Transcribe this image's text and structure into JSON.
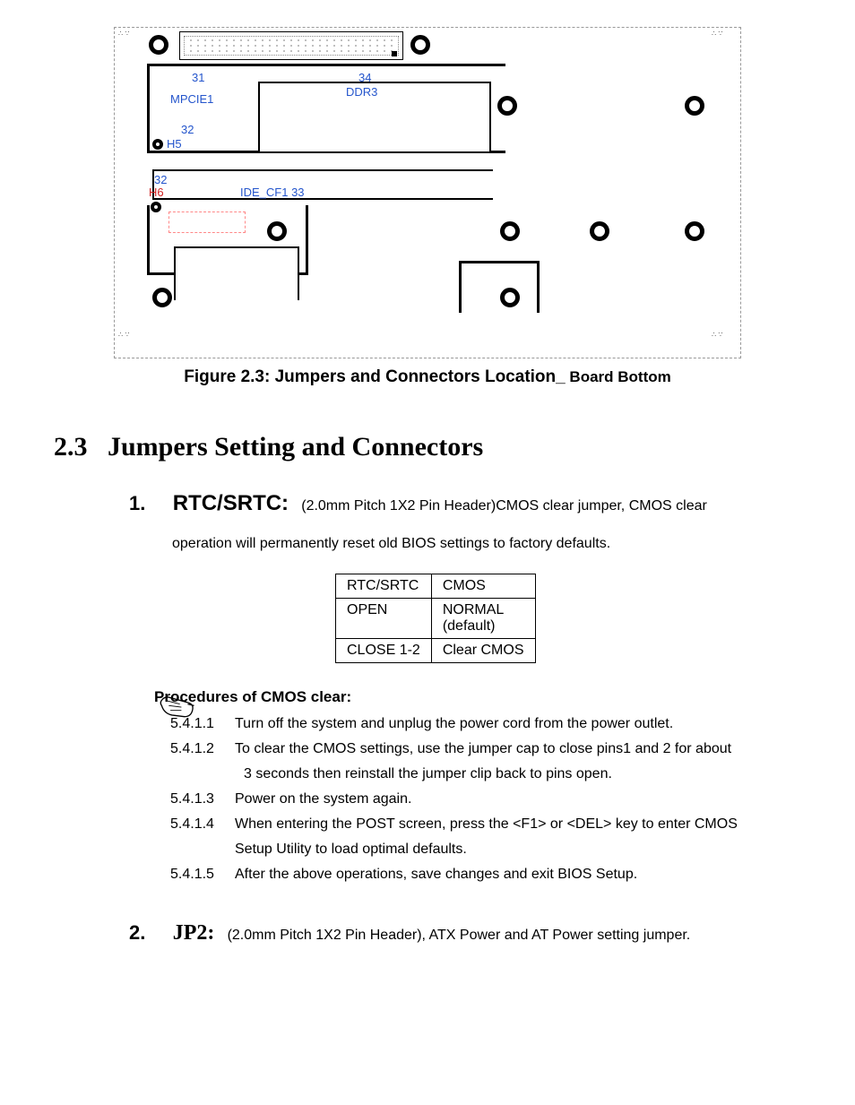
{
  "diagram": {
    "labels": {
      "l31": "31",
      "mpcie": "MPCIE1",
      "l32": "32",
      "h5": "H5",
      "l34": "34",
      "ddr3": "DDR3",
      "l32b": "32",
      "h6": "H6",
      "idecf": "IDE_CF1 33"
    }
  },
  "figure_caption": {
    "main": "Figure 2.3: Jumpers and Connectors Location_",
    "sub": " Board Bottom"
  },
  "section": {
    "number": "2.3",
    "title": "Jumpers Setting and Connectors"
  },
  "item1": {
    "num": "1.",
    "name": "RTC/SRTC:",
    "desc_line1": "(2.0mm Pitch 1X2 Pin Header)CMOS clear jumper, CMOS clear",
    "desc_line2": "operation will permanently reset old BIOS settings to factory defaults."
  },
  "table": {
    "r1c1": "RTC/SRTC",
    "r1c2": "CMOS",
    "r2c1": "OPEN",
    "r2c2a": "NORMAL",
    "r2c2b": "(default)",
    "r3c1": "CLOSE 1-2",
    "r3c2": "Clear CMOS"
  },
  "procedures": {
    "heading": "Procedures of CMOS clear:",
    "steps": [
      {
        "n": "5.4.1.1",
        "t": "Turn off the system and unplug the power cord from the power outlet."
      },
      {
        "n": "5.4.1.2",
        "t": "To clear the CMOS settings, use the jumper cap to close pins1 and 2 for about",
        "t2": "3 seconds then reinstall the jumper clip back to pins open."
      },
      {
        "n": "5.4.1.3",
        "t": "Power on the system again."
      },
      {
        "n": "5.4.1.4",
        "t": "When entering the POST screen, press the <F1> or <DEL> key to enter CMOS",
        "t2b": "Setup Utility to load optimal defaults."
      },
      {
        "n": "5.4.1.5",
        "t": "After the above operations, save changes and exit BIOS Setup."
      }
    ]
  },
  "item2": {
    "num": "2.",
    "name": "JP2:",
    "desc": "(2.0mm Pitch 1X2 Pin Header), ATX Power and AT Power setting jumper."
  }
}
